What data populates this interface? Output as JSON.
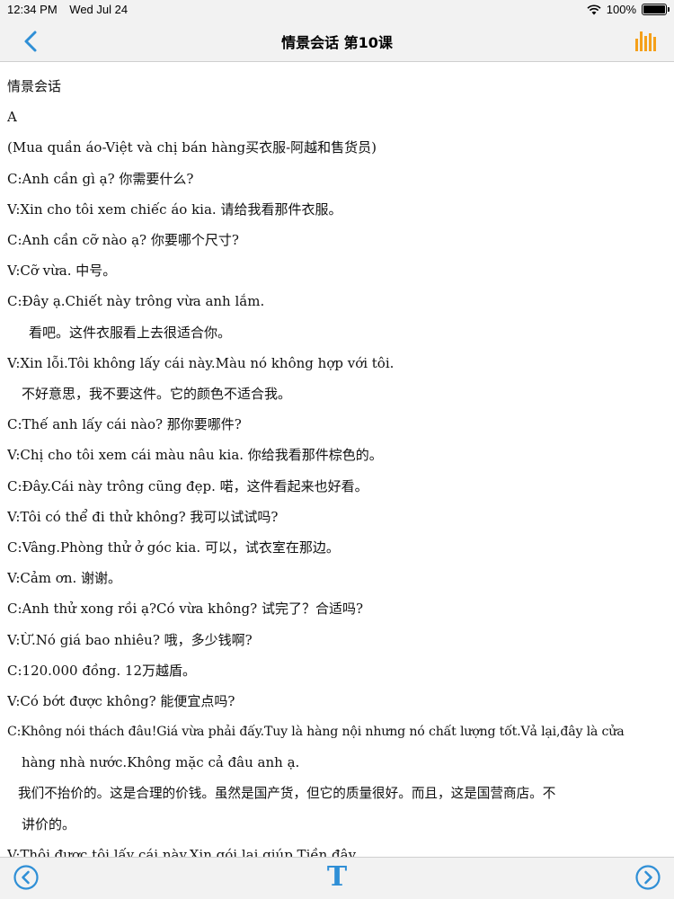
{
  "status_bar": {
    "time": "12:34 PM",
    "date": "Wed Jul 24",
    "battery": "100%",
    "battery_level": 1.0,
    "icons": [
      "wifi-icon",
      "battery-icon"
    ]
  },
  "nav": {
    "title": "情景会话 第10课",
    "back_icon": "chevron-left-icon",
    "right_icon": "bar-chart-icon",
    "accent_color": "#2f8fd6",
    "chart_icon_color": "#f5a01a"
  },
  "content": {
    "heading": "情景会话",
    "section": "A",
    "lines": [
      "(Mua quần áo-Việt và chị bán hàng买衣服-阿越和售货员)",
      "C:Anh cần gì ạ? 你需要什么?",
      "V:Xin cho tôi xem chiếc áo kia. 请给我看那件衣服。",
      "C:Anh cần cỡ nào ạ?  你要哪个尺寸?",
      "V:Cỡ vừa.  中号。",
      "C:Đây ạ.Chiết này trông vừa anh lắm.",
      "看吧。这件衣服看上去很适合你。",
      "V:Xin lỗi.Tôi không lấy cái này.Màu nó không hợp với tôi.",
      "不好意思，我不要这件。它的颜色不适合我。",
      "C:Thế anh lấy cái nào? 那你要哪件?",
      "V:Chị cho tôi xem cái màu nâu kia. 你给我看那件棕色的。",
      "C:Đây.Cái này trông cũng đẹp. 喏，这件看起来也好看。",
      "V:Tôi có thể đi thử không? 我可以试试吗?",
      "C:Vâng.Phòng thử ở góc kia. 可以，试衣室在那边。",
      "V:Cảm ơn. 谢谢。",
      "C:Anh thử xong rồi ạ?Có vừa không? 试完了？合适吗?",
      "V:Ừ.Nó giá bao nhiêu? 哦，多少钱啊?",
      "C:120.000 đồng. 12万越盾。",
      "V:Có bớt được không? 能便宜点吗?",
      "C:Không nói thách đâu!Giá vừa phải đấy.Tuy là hàng nội nhưng nó chất lượng tốt.Vả lại,đây là cửa",
      "hàng nhà nước.Không mặc cả đâu anh ạ.",
      "我们不抬价的。这是合理的价钱。虽然是国产货，但它的质量很好。而且，这是国营商店。不",
      "讲价的。",
      "V:Thôi được,tôi lấy cái này.Xin gói lại giúp.Tiền đây."
    ]
  },
  "bottom_bar": {
    "prev_icon": "circle-chevron-left-icon",
    "font_label": "T",
    "next_icon": "circle-chevron-right-icon"
  }
}
